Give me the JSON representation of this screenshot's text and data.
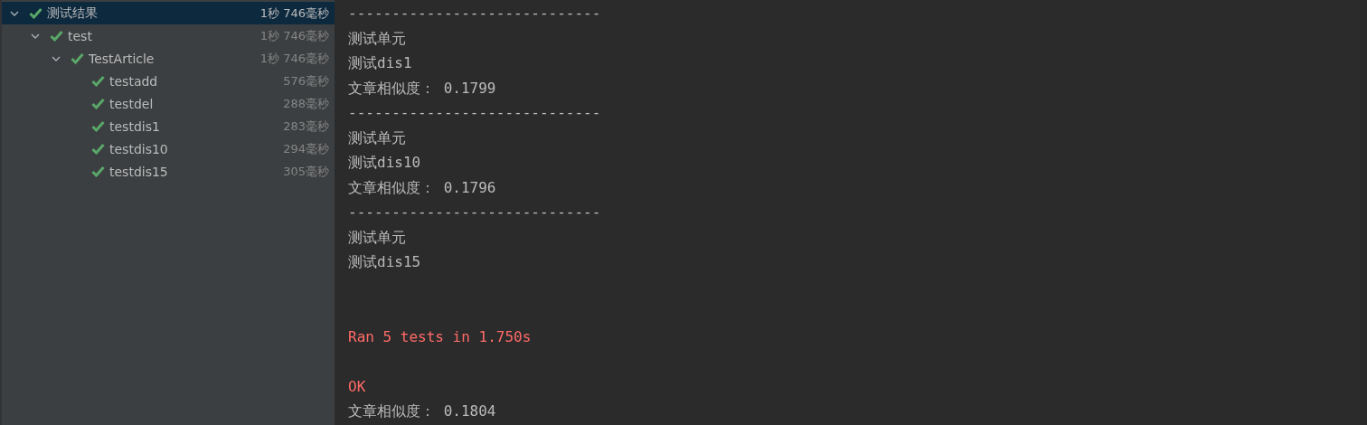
{
  "test_tree": [
    {
      "label": "测试结果",
      "time": "1秒 746毫秒",
      "selected": true,
      "expanded": true,
      "children": [
        {
          "label": "test",
          "time": "1秒 746毫秒",
          "selected": false,
          "expanded": true,
          "children": [
            {
              "label": "TestArticle",
              "time": "1秒 746毫秒",
              "selected": false,
              "expanded": true,
              "children": [
                {
                  "label": "testadd",
                  "time": "576毫秒",
                  "selected": false
                },
                {
                  "label": "testdel",
                  "time": "288毫秒",
                  "selected": false
                },
                {
                  "label": "testdis1",
                  "time": "283毫秒",
                  "selected": false
                },
                {
                  "label": "testdis10",
                  "time": "294毫秒",
                  "selected": false
                },
                {
                  "label": "testdis15",
                  "time": "305毫秒",
                  "selected": false
                }
              ]
            }
          ]
        }
      ]
    }
  ],
  "console": [
    {
      "kind": "stdout",
      "text": "-----------------------------"
    },
    {
      "kind": "stdout",
      "text": "测试单元"
    },
    {
      "kind": "stdout",
      "text": "测试dis1"
    },
    {
      "kind": "stdout",
      "text": "文章相似度： 0.1799"
    },
    {
      "kind": "stdout",
      "text": "-----------------------------"
    },
    {
      "kind": "stdout",
      "text": "测试单元"
    },
    {
      "kind": "stdout",
      "text": "测试dis10"
    },
    {
      "kind": "stdout",
      "text": "文章相似度： 0.1796"
    },
    {
      "kind": "stdout",
      "text": "-----------------------------"
    },
    {
      "kind": "stdout",
      "text": "测试单元"
    },
    {
      "kind": "stdout",
      "text": "测试dis15"
    },
    {
      "kind": "blank"
    },
    {
      "kind": "blank"
    },
    {
      "kind": "stderr",
      "text": "Ran 5 tests in 1.750s"
    },
    {
      "kind": "blank"
    },
    {
      "kind": "stderr",
      "text": "OK"
    },
    {
      "kind": "stdout",
      "text": "文章相似度： 0.1804"
    }
  ]
}
